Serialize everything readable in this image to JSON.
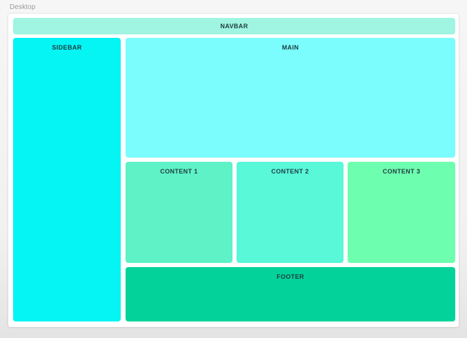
{
  "caption": "Desktop",
  "regions": {
    "navbar": {
      "label": "NAVBAR",
      "color": "#9ff5e1"
    },
    "sidebar": {
      "label": "SIDEBAR",
      "color": "#05f4f4"
    },
    "main": {
      "label": "MAIN",
      "color": "#7bfdfd"
    },
    "content1": {
      "label": "CONTENT 1",
      "color": "#5ef2c6"
    },
    "content2": {
      "label": "CONTENT 2",
      "color": "#58f8d8"
    },
    "content3": {
      "label": "CONTENT 3",
      "color": "#6efeaf"
    },
    "footer": {
      "label": "FOOTER",
      "color": "#03d39a"
    }
  }
}
